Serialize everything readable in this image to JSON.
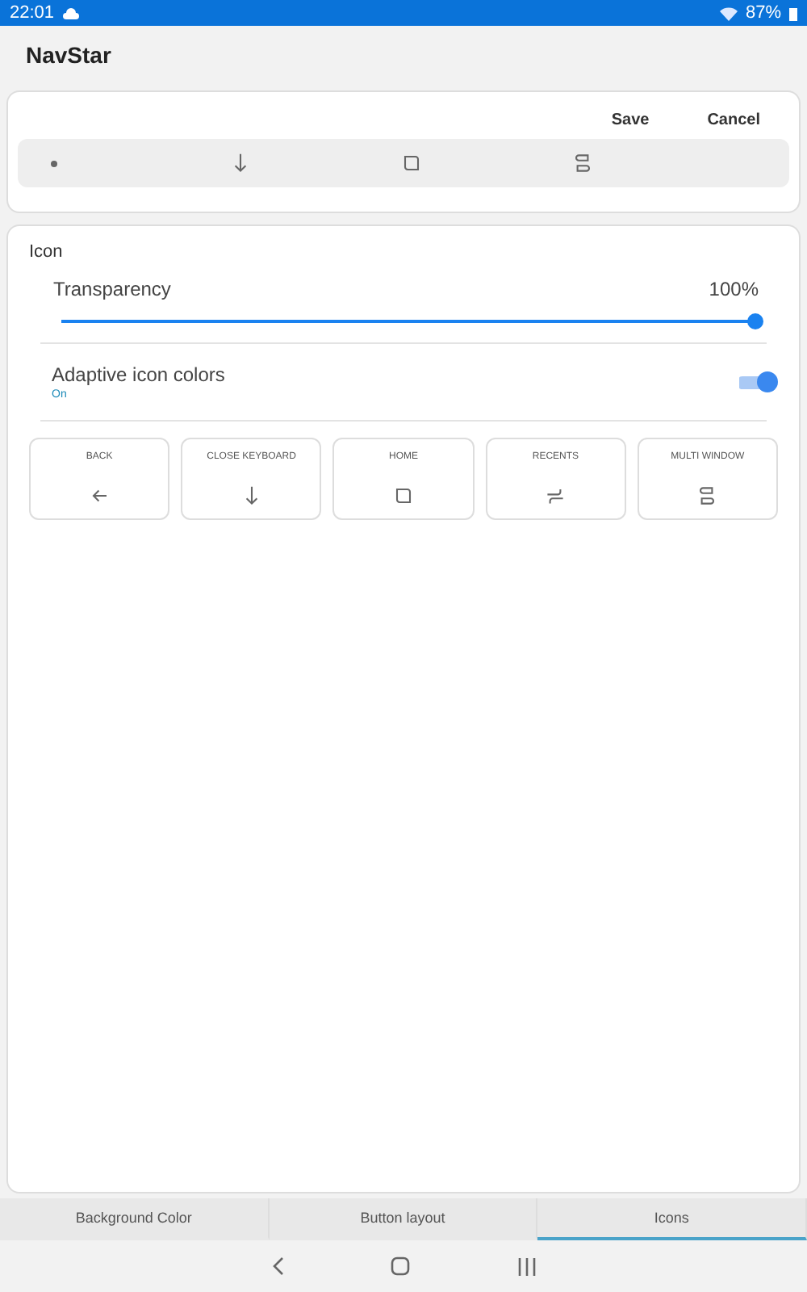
{
  "status_bar": {
    "time": "22:01",
    "battery": "87%"
  },
  "app_bar": {
    "title": "NavStar"
  },
  "preview": {
    "actions": [
      "Save",
      "Cancel"
    ],
    "icons": [
      {
        "kind": "dot"
      },
      {
        "kind": "close_keyboard"
      },
      {
        "kind": "home"
      },
      {
        "kind": "multi_window"
      }
    ]
  },
  "icon_section": {
    "title": "Icon",
    "transparency": {
      "label": "Transparency",
      "reading": "100%",
      "level": 1.0
    },
    "adaptive": {
      "label": "Adaptive icon colors",
      "status": "On",
      "on": true
    },
    "buttons": [
      {
        "label": "BACK",
        "kind": "back"
      },
      {
        "label": "CLOSE KEYBOARD",
        "kind": "close_keyboard"
      },
      {
        "label": "HOME",
        "kind": "home"
      },
      {
        "label": "RECENTS",
        "kind": "recents"
      },
      {
        "label": "MULTI WINDOW",
        "kind": "multi_window"
      }
    ]
  },
  "tabs": [
    {
      "label": "Background Color",
      "selected": false
    },
    {
      "label": "Button layout",
      "selected": false
    },
    {
      "label": "Icons",
      "selected": true
    }
  ]
}
